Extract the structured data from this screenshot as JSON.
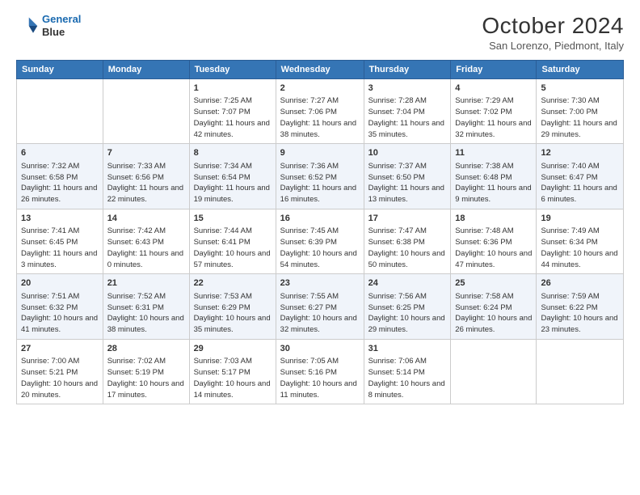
{
  "logo": {
    "line1": "General",
    "line2": "Blue"
  },
  "title": "October 2024",
  "subtitle": "San Lorenzo, Piedmont, Italy",
  "header_days": [
    "Sunday",
    "Monday",
    "Tuesday",
    "Wednesday",
    "Thursday",
    "Friday",
    "Saturday"
  ],
  "weeks": [
    [
      {
        "day": "",
        "info": ""
      },
      {
        "day": "",
        "info": ""
      },
      {
        "day": "1",
        "info": "Sunrise: 7:25 AM\nSunset: 7:07 PM\nDaylight: 11 hours and 42 minutes."
      },
      {
        "day": "2",
        "info": "Sunrise: 7:27 AM\nSunset: 7:06 PM\nDaylight: 11 hours and 38 minutes."
      },
      {
        "day": "3",
        "info": "Sunrise: 7:28 AM\nSunset: 7:04 PM\nDaylight: 11 hours and 35 minutes."
      },
      {
        "day": "4",
        "info": "Sunrise: 7:29 AM\nSunset: 7:02 PM\nDaylight: 11 hours and 32 minutes."
      },
      {
        "day": "5",
        "info": "Sunrise: 7:30 AM\nSunset: 7:00 PM\nDaylight: 11 hours and 29 minutes."
      }
    ],
    [
      {
        "day": "6",
        "info": "Sunrise: 7:32 AM\nSunset: 6:58 PM\nDaylight: 11 hours and 26 minutes."
      },
      {
        "day": "7",
        "info": "Sunrise: 7:33 AM\nSunset: 6:56 PM\nDaylight: 11 hours and 22 minutes."
      },
      {
        "day": "8",
        "info": "Sunrise: 7:34 AM\nSunset: 6:54 PM\nDaylight: 11 hours and 19 minutes."
      },
      {
        "day": "9",
        "info": "Sunrise: 7:36 AM\nSunset: 6:52 PM\nDaylight: 11 hours and 16 minutes."
      },
      {
        "day": "10",
        "info": "Sunrise: 7:37 AM\nSunset: 6:50 PM\nDaylight: 11 hours and 13 minutes."
      },
      {
        "day": "11",
        "info": "Sunrise: 7:38 AM\nSunset: 6:48 PM\nDaylight: 11 hours and 9 minutes."
      },
      {
        "day": "12",
        "info": "Sunrise: 7:40 AM\nSunset: 6:47 PM\nDaylight: 11 hours and 6 minutes."
      }
    ],
    [
      {
        "day": "13",
        "info": "Sunrise: 7:41 AM\nSunset: 6:45 PM\nDaylight: 11 hours and 3 minutes."
      },
      {
        "day": "14",
        "info": "Sunrise: 7:42 AM\nSunset: 6:43 PM\nDaylight: 11 hours and 0 minutes."
      },
      {
        "day": "15",
        "info": "Sunrise: 7:44 AM\nSunset: 6:41 PM\nDaylight: 10 hours and 57 minutes."
      },
      {
        "day": "16",
        "info": "Sunrise: 7:45 AM\nSunset: 6:39 PM\nDaylight: 10 hours and 54 minutes."
      },
      {
        "day": "17",
        "info": "Sunrise: 7:47 AM\nSunset: 6:38 PM\nDaylight: 10 hours and 50 minutes."
      },
      {
        "day": "18",
        "info": "Sunrise: 7:48 AM\nSunset: 6:36 PM\nDaylight: 10 hours and 47 minutes."
      },
      {
        "day": "19",
        "info": "Sunrise: 7:49 AM\nSunset: 6:34 PM\nDaylight: 10 hours and 44 minutes."
      }
    ],
    [
      {
        "day": "20",
        "info": "Sunrise: 7:51 AM\nSunset: 6:32 PM\nDaylight: 10 hours and 41 minutes."
      },
      {
        "day": "21",
        "info": "Sunrise: 7:52 AM\nSunset: 6:31 PM\nDaylight: 10 hours and 38 minutes."
      },
      {
        "day": "22",
        "info": "Sunrise: 7:53 AM\nSunset: 6:29 PM\nDaylight: 10 hours and 35 minutes."
      },
      {
        "day": "23",
        "info": "Sunrise: 7:55 AM\nSunset: 6:27 PM\nDaylight: 10 hours and 32 minutes."
      },
      {
        "day": "24",
        "info": "Sunrise: 7:56 AM\nSunset: 6:25 PM\nDaylight: 10 hours and 29 minutes."
      },
      {
        "day": "25",
        "info": "Sunrise: 7:58 AM\nSunset: 6:24 PM\nDaylight: 10 hours and 26 minutes."
      },
      {
        "day": "26",
        "info": "Sunrise: 7:59 AM\nSunset: 6:22 PM\nDaylight: 10 hours and 23 minutes."
      }
    ],
    [
      {
        "day": "27",
        "info": "Sunrise: 7:00 AM\nSunset: 5:21 PM\nDaylight: 10 hours and 20 minutes."
      },
      {
        "day": "28",
        "info": "Sunrise: 7:02 AM\nSunset: 5:19 PM\nDaylight: 10 hours and 17 minutes."
      },
      {
        "day": "29",
        "info": "Sunrise: 7:03 AM\nSunset: 5:17 PM\nDaylight: 10 hours and 14 minutes."
      },
      {
        "day": "30",
        "info": "Sunrise: 7:05 AM\nSunset: 5:16 PM\nDaylight: 10 hours and 11 minutes."
      },
      {
        "day": "31",
        "info": "Sunrise: 7:06 AM\nSunset: 5:14 PM\nDaylight: 10 hours and 8 minutes."
      },
      {
        "day": "",
        "info": ""
      },
      {
        "day": "",
        "info": ""
      }
    ]
  ]
}
